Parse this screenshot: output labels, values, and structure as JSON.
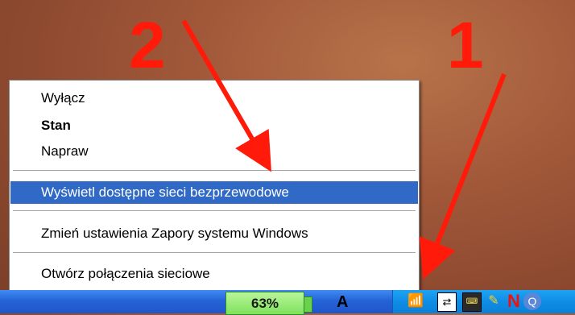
{
  "annotations": {
    "label_2": "2",
    "label_1": "1"
  },
  "context_menu": {
    "items": [
      {
        "label": "Wyłącz"
      },
      {
        "label": "Stan"
      },
      {
        "label": "Napraw"
      },
      {
        "label": "Wyświetl dostępne sieci bezprzewodowe"
      },
      {
        "label": "Zmień ustawienia Zapory systemu Windows"
      },
      {
        "label": "Otwórz połączenia sieciowe"
      }
    ]
  },
  "taskbar": {
    "battery_label": "63%",
    "language_indicator": "A",
    "tray_icons": [
      "wireless-network-icon",
      "network-monitor-icon",
      "keyboard-icon",
      "pen-icon",
      "norton-icon",
      "quicktime-icon"
    ]
  },
  "colors": {
    "highlight": "#3169c6",
    "annotation": "#ff1a0a",
    "taskbar": "#2563d8",
    "tray": "#0f8de6"
  }
}
